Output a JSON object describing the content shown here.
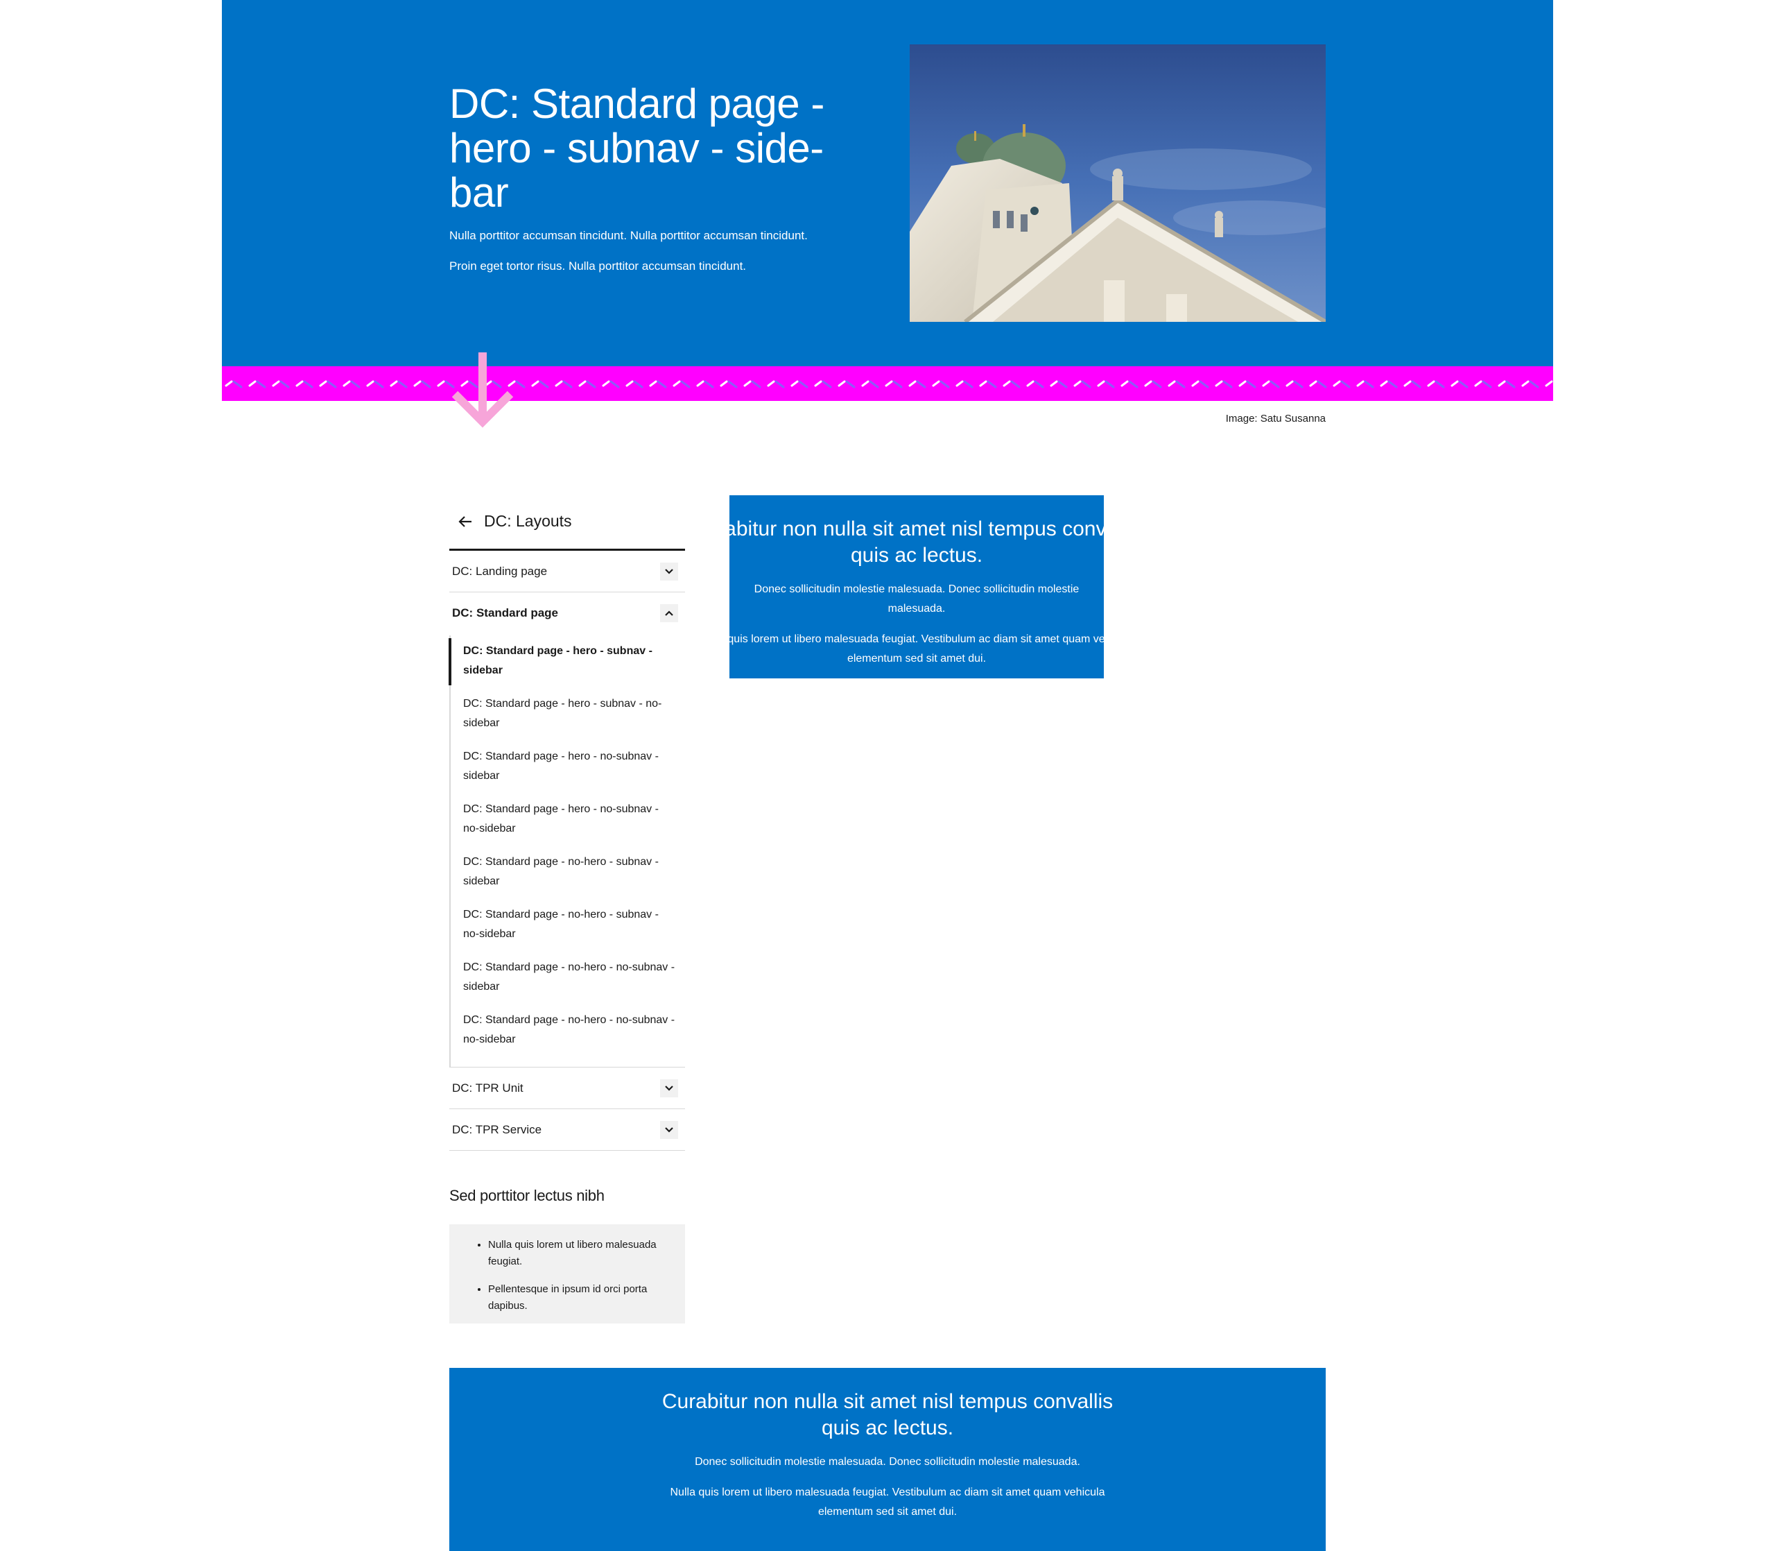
{
  "hero": {
    "title": "DC: Standard page - hero - subnav - side-bar",
    "paragraphs": [
      "Nulla porttitor accumsan tincidunt. Nulla porttitor accumsan tincidunt.",
      "Proin eget tortor risus. Nulla porttitor accumsan tincidunt."
    ],
    "image_credit": "Image: Satu Susanna",
    "background_color": "#0072c6",
    "koros_color": "#ff00ff",
    "arrow_color": "#f7a5d9"
  },
  "sidenav": {
    "back_label": "DC: Layouts",
    "items": [
      {
        "label": "DC: Landing page",
        "expanded": false
      },
      {
        "label": "DC: Standard page",
        "expanded": true
      }
    ],
    "subitems": [
      {
        "label": "DC: Standard page - hero - subnav - sidebar",
        "active": true
      },
      {
        "label": "DC: Standard page - hero - subnav - no-sidebar",
        "active": false
      },
      {
        "label": "DC: Standard page - hero - no-subnav - sidebar",
        "active": false
      },
      {
        "label": "DC: Standard page - hero - no-subnav - no-sidebar",
        "active": false
      },
      {
        "label": "DC: Standard page - no-hero - subnav - sidebar",
        "active": false
      },
      {
        "label": "DC: Standard page - no-hero - subnav - no-sidebar",
        "active": false
      },
      {
        "label": "DC: Standard page - no-hero - no-subnav - sidebar",
        "active": false
      },
      {
        "label": "DC: Standard page - no-hero - no-subnav - no-sidebar",
        "active": false
      }
    ],
    "items_after": [
      {
        "label": "DC: TPR Unit",
        "expanded": false
      },
      {
        "label": "DC: TPR Service",
        "expanded": false
      }
    ]
  },
  "sidebar": {
    "title": "Sed porttitor lectus nibh",
    "list": [
      "Nulla quis lorem ut libero malesuada feugiat.",
      "Pellentesque in ipsum id orci porta dapibus."
    ]
  },
  "banner_main": {
    "title": "Curabitur non nulla sit amet nisl tempus convallis quis ac lectus.",
    "p1": "Donec sollicitudin molestie malesuada. Donec sollicitudin molestie malesuada.",
    "p2": "Nulla quis lorem ut libero malesuada feugiat. Vestibulum ac diam sit amet quam vehicula elementum sed sit amet dui."
  },
  "banner_bottom": {
    "title": "Curabitur non nulla sit amet nisl tempus convallis quis ac lectus.",
    "p1": "Donec sollicitudin molestie malesuada. Donec sollicitudin molestie malesuada.",
    "p2": "Nulla quis lorem ut libero malesuada feugiat. Vestibulum ac diam sit amet quam vehicula elementum sed sit amet dui."
  }
}
